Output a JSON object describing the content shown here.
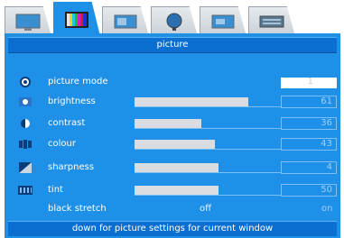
{
  "tabs": [
    {
      "icon": "tv-icon"
    },
    {
      "icon": "color-bars-icon",
      "active": true
    },
    {
      "icon": "speaker-icon"
    },
    {
      "icon": "satellite-dish-icon"
    },
    {
      "icon": "screen-settings-icon"
    },
    {
      "icon": "keyboard-icon"
    }
  ],
  "panel": {
    "title": "picture",
    "footer": "down for picture settings for current window"
  },
  "settings": [
    {
      "id": "picture-mode",
      "icon": "picture-mode-icon",
      "label": "picture mode",
      "value": "1"
    },
    {
      "id": "brightness",
      "icon": "brightness-icon",
      "label": "brightness",
      "value": "61",
      "level": 0.61
    },
    {
      "id": "contrast",
      "icon": "contrast-icon",
      "label": "contrast",
      "value": "36",
      "level": 0.36
    },
    {
      "id": "colour",
      "icon": "colour-icon",
      "label": "colour",
      "value": "43",
      "level": 0.43
    },
    {
      "id": "sharpness",
      "icon": "sharpness-icon",
      "label": "sharpness",
      "value": "4",
      "level": 0.45
    },
    {
      "id": "tint",
      "icon": "tint-icon",
      "label": "tint",
      "value": "50",
      "level": 0.45
    }
  ],
  "black_stretch": {
    "label": "black stretch",
    "off": "off",
    "on": "on",
    "selected": "off"
  },
  "colors": {
    "accent": "#1e90e8",
    "header": "#0a6fd1",
    "slider_fill": "#d9dde1"
  }
}
